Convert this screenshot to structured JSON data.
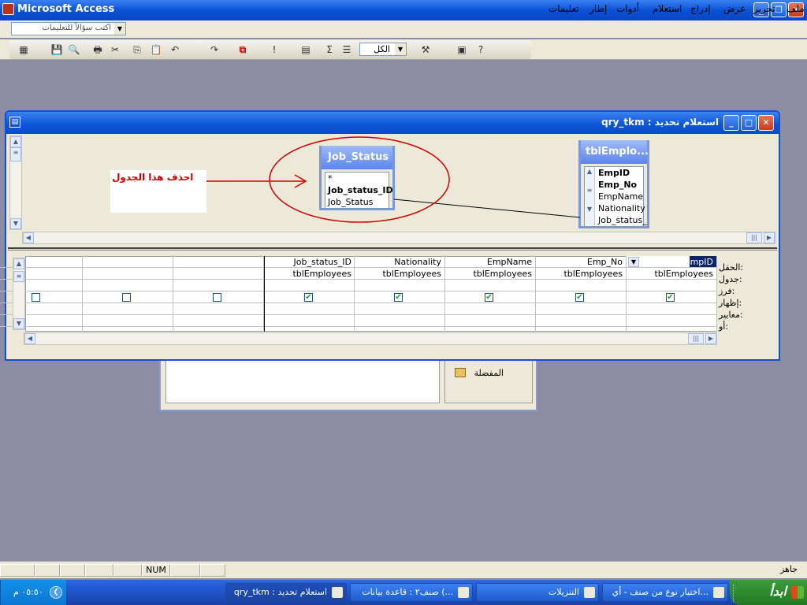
{
  "app": {
    "title": "Microsoft Access"
  },
  "window_buttons": {
    "minimize": "_",
    "restore": "❐",
    "close": "✕"
  },
  "menu": {
    "items": [
      "ملف",
      "تحرير",
      "عرض",
      "إدراج",
      "استعلام",
      "أدوات",
      "إطار",
      "تعليمات"
    ]
  },
  "ask": {
    "placeholder": "اكتب سؤالاً للتعليمات"
  },
  "toolbar": {
    "top_values": "الكل",
    "icons": [
      "datasheet-view-icon",
      "save-icon",
      "print-icon",
      "cut-icon",
      "copy-icon",
      "paste-icon",
      "undo-icon",
      "redo-icon",
      "query-type-icon",
      "run-icon",
      "show-table-icon",
      "totals-icon",
      "properties-icon",
      "build-icon",
      "database-window-icon",
      "new-object-icon",
      "help-icon"
    ]
  },
  "query_window": {
    "title": "qry_tkm : استعلام تحديد",
    "tables": [
      {
        "name": "Job_Status",
        "fields": [
          "*",
          "Job_status_ID",
          "Job_Status"
        ],
        "bold": [
          false,
          true,
          false
        ]
      },
      {
        "name": "tblEmplo...",
        "fields": [
          "EmpID",
          "Emp_No",
          "EmpName",
          "Nationality",
          "Job_status_"
        ],
        "bold": [
          true,
          true,
          false,
          false,
          false
        ]
      }
    ],
    "annotation": "احذف هذا الجدول",
    "row_labels": [
      "الحقل:",
      "جدول:",
      "فرز:",
      "إظهار:",
      "معايير:",
      "أو:"
    ],
    "columns": [
      {
        "field": "EmpID",
        "table": "tblEmployees",
        "show": true
      },
      {
        "field": "Emp_No",
        "table": "tblEmployees",
        "show": true
      },
      {
        "field": "EmpName",
        "table": "tblEmployees",
        "show": true
      },
      {
        "field": "Nationality",
        "table": "tblEmployees",
        "show": true
      },
      {
        "field": "Job_status_ID",
        "table": "tblEmployees",
        "show": true
      },
      {
        "field": "",
        "table": "",
        "show": false
      },
      {
        "field": "",
        "table": "",
        "show": false
      },
      {
        "field": "",
        "table": "",
        "show": false
      }
    ]
  },
  "db_window": {
    "favorites": "المفضلة"
  },
  "status": {
    "ready": "جاهز",
    "num": "NUM"
  },
  "taskbar": {
    "start": "ابدأ",
    "tasks": [
      "اختيار نوع من صنف - أي...",
      "التنزيلات",
      "صنف٢ : قاعدة بيانات (...",
      "qry_tkm : استعلام تحديد"
    ],
    "clock": "٠٥:٥٠ م"
  }
}
